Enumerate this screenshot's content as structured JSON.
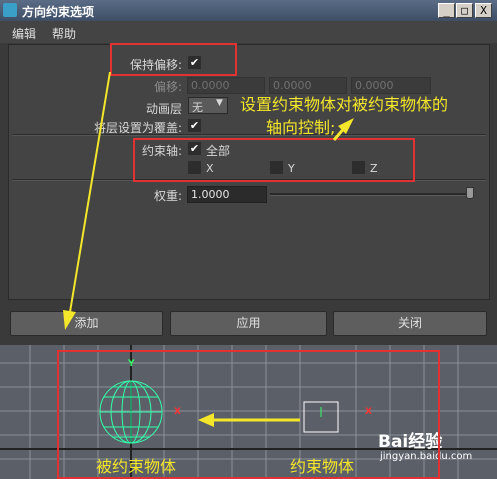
{
  "window": {
    "title": "方向约束选项",
    "min": "_",
    "max": "□",
    "close": "X"
  },
  "menu": [
    "编辑",
    "帮助"
  ],
  "options": {
    "maintain_offset_label": "保持偏移:",
    "maintain_offset_checked": "✔",
    "offset_label": "偏移:",
    "offset_values": [
      "0.0000",
      "0.0000",
      "0.0000"
    ],
    "anim_layer_label": "动画层",
    "anim_layer_value": "无",
    "set_layer_override_label": "将层设置为覆盖:",
    "set_layer_override_checked": "✔",
    "constraint_axes_label": "约束轴:",
    "all_label": "全部",
    "all_checked": "✔",
    "axes": [
      "X",
      "Y",
      "Z"
    ],
    "weight_label": "权重:",
    "weight_value": "1.0000"
  },
  "buttons": {
    "add": "添加",
    "apply": "应用",
    "close": "关闭"
  },
  "annotations": {
    "note": "设置约束物体对被约束物体的轴向控制;",
    "note_line1": "设置约束物体对被约束物体的",
    "note_line2": "轴向控制;",
    "constrained": "被约束物体",
    "constrainer": "约束物体"
  },
  "viewport": {
    "axis_y": "Y",
    "axis_x": "X",
    "watermark_site": "jingyan.baidu.com",
    "watermark_brand": "Bai经验"
  },
  "colors": {
    "annotation_red": "#e03232",
    "annotation_yellow": "#f4e62a",
    "wire_green": "#33ffaa"
  }
}
